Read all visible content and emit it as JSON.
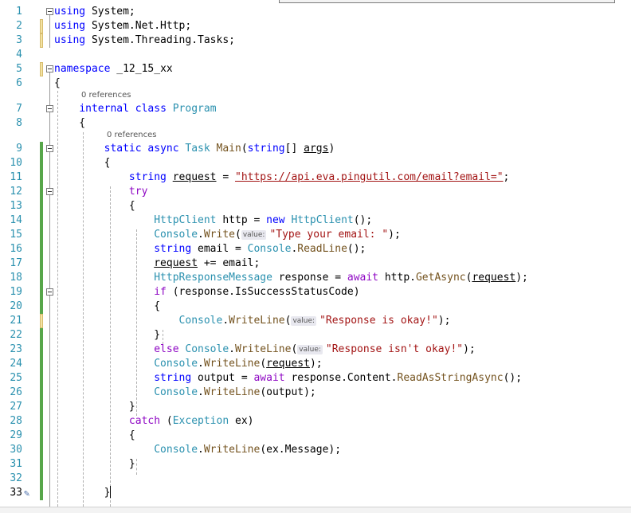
{
  "editor": {
    "lines": [
      {
        "n": "1",
        "bar": "none",
        "fold": true,
        "segs": [
          {
            "t": "using",
            "c": "kw"
          },
          {
            "t": " System;"
          }
        ]
      },
      {
        "n": "2",
        "bar": "yellow",
        "segs": [
          {
            "t": "using",
            "c": "kw"
          },
          {
            "t": " System.Net.Http;"
          }
        ]
      },
      {
        "n": "3",
        "bar": "yellow",
        "segs": [
          {
            "t": "using",
            "c": "kw"
          },
          {
            "t": " System.Threading.Tasks;"
          }
        ]
      },
      {
        "n": "4",
        "bar": "none",
        "segs": []
      },
      {
        "n": "5",
        "bar": "yellow",
        "fold": true,
        "segs": [
          {
            "t": "namespace",
            "c": "kw"
          },
          {
            "t": " _12_15_xx"
          }
        ]
      },
      {
        "n": "6",
        "bar": "none",
        "segs": [
          {
            "t": "{"
          }
        ]
      },
      {
        "n": "7",
        "bar": "none",
        "fold": true,
        "refs": "0 references",
        "segs": [
          {
            "t": "    "
          },
          {
            "t": "internal",
            "c": "kw"
          },
          {
            "t": " "
          },
          {
            "t": "class",
            "c": "kw"
          },
          {
            "t": " "
          },
          {
            "t": "Program",
            "c": "type"
          }
        ]
      },
      {
        "n": "8",
        "bar": "none",
        "segs": [
          {
            "t": "    {"
          }
        ]
      },
      {
        "n": "9",
        "bar": "green",
        "fold": true,
        "refs": "0 references",
        "segs": [
          {
            "t": "        "
          },
          {
            "t": "static",
            "c": "kw"
          },
          {
            "t": " "
          },
          {
            "t": "async",
            "c": "kw"
          },
          {
            "t": " "
          },
          {
            "t": "Task",
            "c": "type"
          },
          {
            "t": " "
          },
          {
            "t": "Main",
            "c": "mth"
          },
          {
            "t": "("
          },
          {
            "t": "string",
            "c": "kw"
          },
          {
            "t": "[] "
          },
          {
            "t": "args",
            "c": "ul"
          },
          {
            "t": ")"
          }
        ]
      },
      {
        "n": "10",
        "bar": "green",
        "segs": [
          {
            "t": "        {"
          }
        ]
      },
      {
        "n": "11",
        "bar": "green",
        "segs": [
          {
            "t": "            "
          },
          {
            "t": "string",
            "c": "kw"
          },
          {
            "t": " "
          },
          {
            "t": "request",
            "c": "ul"
          },
          {
            "t": " = "
          },
          {
            "t": "\"https://api.eva.pingutil.com/email?email=\"",
            "c": "str ul"
          },
          {
            "t": ";"
          }
        ]
      },
      {
        "n": "12",
        "bar": "green",
        "fold": true,
        "segs": [
          {
            "t": "            "
          },
          {
            "t": "try",
            "c": "ctl"
          }
        ]
      },
      {
        "n": "13",
        "bar": "green",
        "segs": [
          {
            "t": "            {"
          }
        ]
      },
      {
        "n": "14",
        "bar": "green",
        "segs": [
          {
            "t": "                "
          },
          {
            "t": "HttpClient",
            "c": "type"
          },
          {
            "t": " http = "
          },
          {
            "t": "new",
            "c": "kw"
          },
          {
            "t": " "
          },
          {
            "t": "HttpClient",
            "c": "type"
          },
          {
            "t": "();"
          }
        ]
      },
      {
        "n": "15",
        "bar": "green",
        "segs": [
          {
            "t": "                "
          },
          {
            "t": "Console",
            "c": "type"
          },
          {
            "t": "."
          },
          {
            "t": "Write",
            "c": "mth"
          },
          {
            "t": "("
          },
          {
            "hint": "value:"
          },
          {
            "t": "\"Type your email: \"",
            "c": "str"
          },
          {
            "t": ");"
          }
        ]
      },
      {
        "n": "16",
        "bar": "green",
        "segs": [
          {
            "t": "                "
          },
          {
            "t": "string",
            "c": "kw"
          },
          {
            "t": " email = "
          },
          {
            "t": "Console",
            "c": "type"
          },
          {
            "t": "."
          },
          {
            "t": "ReadLine",
            "c": "mth"
          },
          {
            "t": "();"
          }
        ]
      },
      {
        "n": "17",
        "bar": "green",
        "segs": [
          {
            "t": "                "
          },
          {
            "t": "request",
            "c": "ul"
          },
          {
            "t": " += email;"
          }
        ]
      },
      {
        "n": "18",
        "bar": "green",
        "segs": [
          {
            "t": "                "
          },
          {
            "t": "HttpResponseMessage",
            "c": "type"
          },
          {
            "t": " response = "
          },
          {
            "t": "await",
            "c": "ctl"
          },
          {
            "t": " http."
          },
          {
            "t": "GetAsync",
            "c": "mth"
          },
          {
            "t": "("
          },
          {
            "t": "request",
            "c": "ul"
          },
          {
            "t": ");"
          }
        ]
      },
      {
        "n": "19",
        "bar": "green",
        "fold": true,
        "segs": [
          {
            "t": "                "
          },
          {
            "t": "if",
            "c": "ctl"
          },
          {
            "t": " (response.IsSuccessStatusCode)"
          }
        ]
      },
      {
        "n": "20",
        "bar": "green",
        "segs": [
          {
            "t": "                {"
          }
        ]
      },
      {
        "n": "21",
        "bar": "yellow",
        "segs": [
          {
            "t": "                    "
          },
          {
            "t": "Console",
            "c": "type"
          },
          {
            "t": "."
          },
          {
            "t": "WriteLine",
            "c": "mth"
          },
          {
            "t": "("
          },
          {
            "hint": "value:"
          },
          {
            "t": "\"Response is okay!\"",
            "c": "str"
          },
          {
            "t": ");"
          }
        ]
      },
      {
        "n": "22",
        "bar": "green",
        "segs": [
          {
            "t": "                }"
          }
        ]
      },
      {
        "n": "23",
        "bar": "green",
        "segs": [
          {
            "t": "                "
          },
          {
            "t": "else",
            "c": "ctl"
          },
          {
            "t": " "
          },
          {
            "t": "Console",
            "c": "type"
          },
          {
            "t": "."
          },
          {
            "t": "WriteLine",
            "c": "mth"
          },
          {
            "t": "("
          },
          {
            "hint": "value:"
          },
          {
            "t": "\"Response isn't okay!\"",
            "c": "str"
          },
          {
            "t": ");"
          }
        ]
      },
      {
        "n": "24",
        "bar": "green",
        "segs": [
          {
            "t": "                "
          },
          {
            "t": "Console",
            "c": "type"
          },
          {
            "t": "."
          },
          {
            "t": "WriteLine",
            "c": "mth"
          },
          {
            "t": "("
          },
          {
            "t": "request",
            "c": "ul"
          },
          {
            "t": ");"
          }
        ]
      },
      {
        "n": "25",
        "bar": "green",
        "segs": [
          {
            "t": "                "
          },
          {
            "t": "string",
            "c": "kw"
          },
          {
            "t": " output = "
          },
          {
            "t": "await",
            "c": "ctl"
          },
          {
            "t": " response.Content."
          },
          {
            "t": "ReadAsStringAsync",
            "c": "mth"
          },
          {
            "t": "();"
          }
        ]
      },
      {
        "n": "26",
        "bar": "green",
        "segs": [
          {
            "t": "                "
          },
          {
            "t": "Console",
            "c": "type"
          },
          {
            "t": "."
          },
          {
            "t": "WriteLine",
            "c": "mth"
          },
          {
            "t": "(output);"
          }
        ]
      },
      {
        "n": "27",
        "bar": "green",
        "segs": [
          {
            "t": "            }"
          }
        ]
      },
      {
        "n": "28",
        "bar": "green",
        "segs": [
          {
            "t": "            "
          },
          {
            "t": "catch",
            "c": "ctl"
          },
          {
            "t": " ("
          },
          {
            "t": "Exception",
            "c": "type"
          },
          {
            "t": " ex)"
          }
        ]
      },
      {
        "n": "29",
        "bar": "green",
        "segs": [
          {
            "t": "            {"
          }
        ]
      },
      {
        "n": "30",
        "bar": "green",
        "segs": [
          {
            "t": "                "
          },
          {
            "t": "Console",
            "c": "type"
          },
          {
            "t": "."
          },
          {
            "t": "WriteLine",
            "c": "mth"
          },
          {
            "t": "(ex.Message);"
          }
        ]
      },
      {
        "n": "31",
        "bar": "green",
        "segs": [
          {
            "t": "            }"
          }
        ]
      },
      {
        "n": "32",
        "bar": "green",
        "segs": []
      },
      {
        "n": "33",
        "bar": "green",
        "cur": true,
        "brush": true,
        "segs": [
          {
            "t": "        }"
          },
          {
            "caret": true
          }
        ]
      }
    ]
  },
  "colors": {
    "keyword": "#0000ff",
    "control": "#8f08c4",
    "type": "#2b91af",
    "string": "#a31515",
    "method": "#74531f",
    "line_number": "#2b91af",
    "change_saved": "#57a64a",
    "change_unsaved": "#f3e2a3"
  },
  "icons": {
    "quick_actions": "paintbrush-icon",
    "outlining": "collapse-toggle-icon"
  }
}
